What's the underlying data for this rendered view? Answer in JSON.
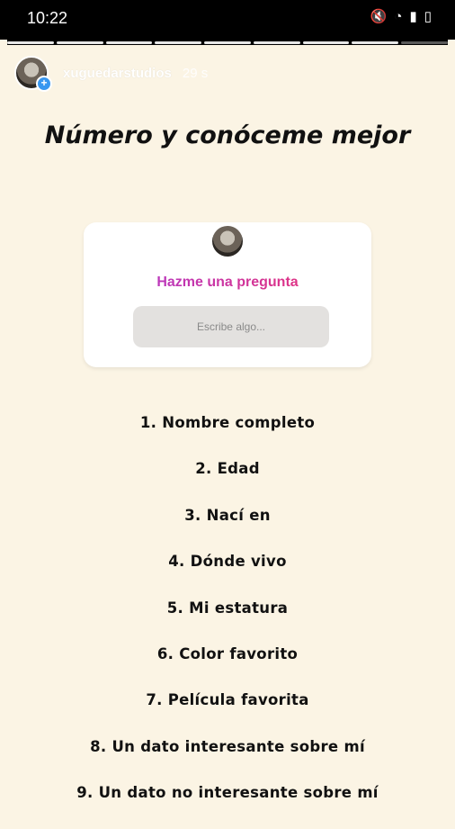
{
  "status_bar": {
    "time": "10:22",
    "icons": [
      "mute-icon",
      "wifi-icon",
      "signal-icon",
      "battery-icon"
    ]
  },
  "story": {
    "segments_total": 9,
    "current_segment": 9,
    "username": "xuguedarstudios",
    "time_ago": "29 s"
  },
  "title": "Número y conóceme mejor",
  "question_sticker": {
    "prompt": "Hazme una pregunta",
    "placeholder": "Escribe algo..."
  },
  "items": [
    "1. Nombre completo",
    "2. Edad",
    "3. Nací en",
    "4. Dónde vivo",
    "5. Mi estatura",
    "6. Color favorito",
    "7. Película favorita",
    "8. Un dato interesante sobre mí",
    "9. Un dato no interesante sobre mí"
  ]
}
